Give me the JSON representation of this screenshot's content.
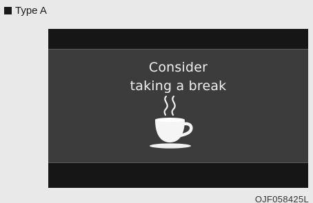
{
  "header": {
    "type_label": "Type A"
  },
  "display": {
    "message_line1": "Consider",
    "message_line2": "taking a break",
    "icon": "coffee-cup-icon"
  },
  "figure": {
    "code": "OJF058425L"
  },
  "colors": {
    "page_background": "#e9e9e9",
    "display_bezel": "#161616",
    "message_panel": "#3c3c3c",
    "message_text": "#f0f0f0"
  }
}
